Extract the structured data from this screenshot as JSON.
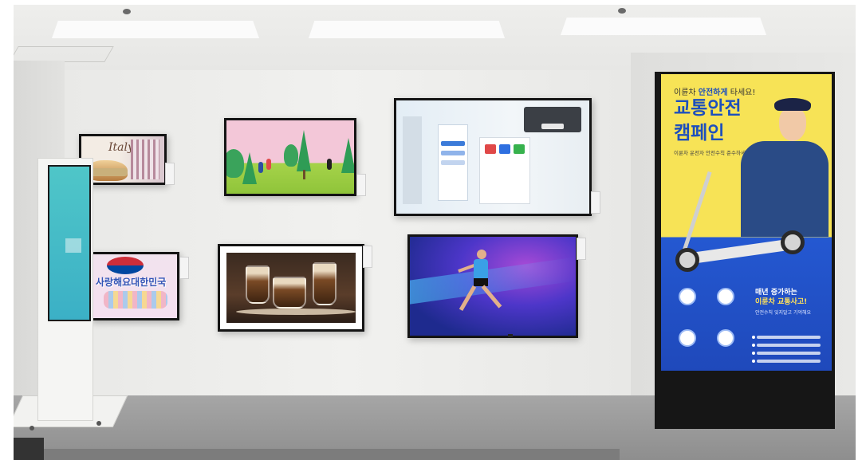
{
  "scene": {
    "poster": {
      "top_line_pre": "이륜차 ",
      "top_line_bold": "안전하게",
      "top_line_post": " 타세요!",
      "title_line1": "교통안전",
      "title_line2": "캠페인",
      "subtitle": "이륜차 운전자 안전수칙 준수하세요.",
      "headline_line1": "매년 증가하는",
      "headline_line2": "이륜차 교통사고!",
      "caption": "안전수칙 잊지말고 기억해요"
    },
    "screen_cake": {
      "lettering": "Italy"
    },
    "screen_flag": {
      "slogan": "사랑해요대한민국"
    },
    "colors": {
      "poster_yellow": "#f7e356",
      "poster_blue": "#2458d1",
      "runner_bg": "#4d36c9"
    }
  }
}
